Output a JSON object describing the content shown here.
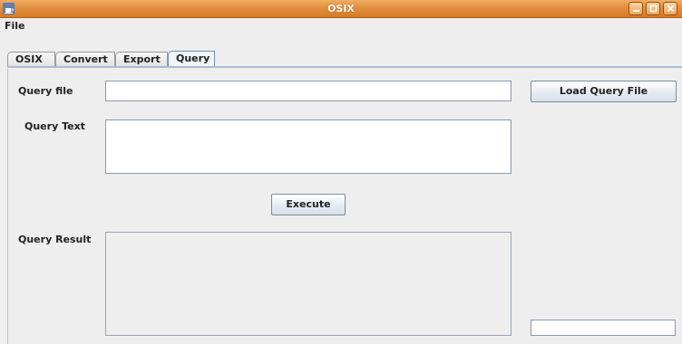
{
  "window": {
    "title": "OSIX",
    "icons": {
      "app": "java-cup-icon",
      "minimize": "minimize-icon",
      "maximize": "maximize-icon",
      "close": "close-icon"
    },
    "colors": {
      "titlebar": "#e28e3d",
      "background": "#eeeeee"
    }
  },
  "menu": {
    "file_label": "File"
  },
  "tabs": [
    {
      "label": "OSIX",
      "selected": false
    },
    {
      "label": "Convert",
      "selected": false
    },
    {
      "label": "Export",
      "selected": false
    },
    {
      "label": "Query",
      "selected": true
    }
  ],
  "query_panel": {
    "query_file_label": "Query file",
    "query_file_value": "",
    "load_button_label": "Load Query File",
    "query_text_label": "Query Text",
    "query_text_value": "",
    "execute_button_label": "Execute",
    "query_result_label": "Query Result",
    "query_result_value": "",
    "status_field_value": ""
  }
}
